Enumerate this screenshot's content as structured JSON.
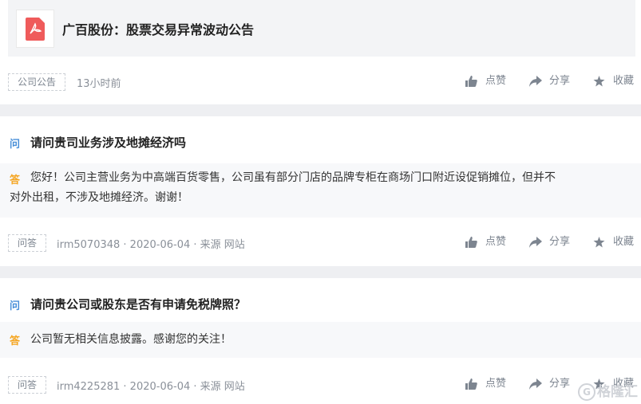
{
  "announcement": {
    "title": "广百股份：股票交易异常波动公告",
    "tag": "公司公告",
    "time": "13小时前"
  },
  "actions": {
    "like": "点赞",
    "share": "分享",
    "favorite": "收藏"
  },
  "qa": [
    {
      "q_marker": "问",
      "a_marker": "答",
      "question": "请问贵司业务涉及地摊经济吗",
      "answer_line1": "您好！公司主营业务为中高端百货零售，公司虽有部分门店的品牌专柜在商场门口附近设促销摊位，但并不",
      "answer_line2": "对外出租，不涉及地摊经济。谢谢！",
      "tag": "问答",
      "meta": "irm5070348 · 2020-06-04 · 来源 网站"
    },
    {
      "q_marker": "问",
      "a_marker": "答",
      "question": "请问贵公司或股东是否有申请免税牌照？",
      "answer_line1": "公司暂无相关信息披露。感谢您的关注！",
      "tag": "问答",
      "meta": "irm4225281 · 2020-06-04 · 来源 网站"
    }
  ],
  "watermark": {
    "glyph": "G",
    "text": "格隆汇"
  },
  "icons": {
    "pdf": "pdf-file-icon",
    "like": "thumbs-up-icon",
    "share": "share-arrow-icon",
    "favorite": "star-icon"
  },
  "colors": {
    "pdf": "#ef5b5b",
    "question": "#4a90d9",
    "answer": "#f5a623"
  }
}
